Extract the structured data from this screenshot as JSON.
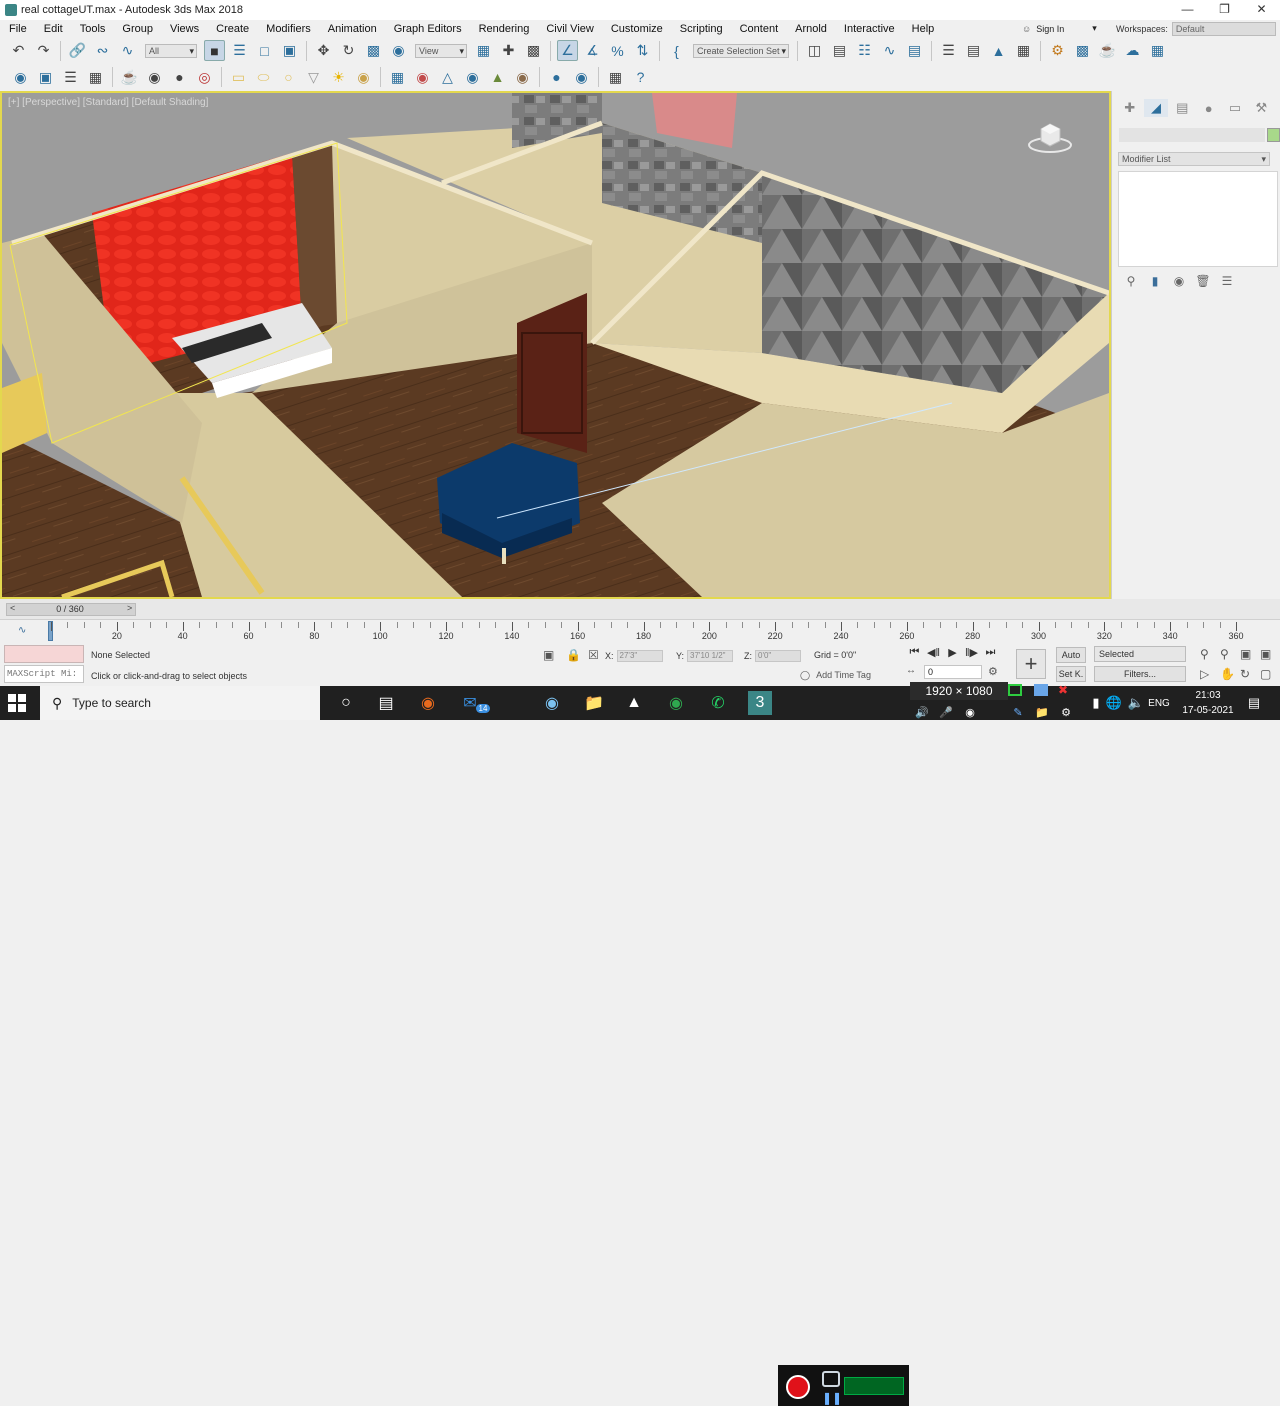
{
  "window": {
    "title": "real cottageUT.max - Autodesk 3ds Max 2018",
    "minimize": "—",
    "maximize": "❐",
    "close": "✕"
  },
  "menu": [
    "File",
    "Edit",
    "Tools",
    "Group",
    "Views",
    "Create",
    "Modifiers",
    "Animation",
    "Graph Editors",
    "Rendering",
    "Civil View",
    "Customize",
    "Scripting",
    "Content",
    "Arnold",
    "Interactive",
    "Help"
  ],
  "account": {
    "sign_in": "Sign In",
    "workspaces_label": "Workspaces:",
    "workspace": "Default"
  },
  "toolbar": {
    "selection_filter": "All",
    "ref_coord": "View",
    "named_selection": "Create Selection Set"
  },
  "viewport": {
    "label": "[+] [Perspective] [Standard] [Default Shading]"
  },
  "command_panel": {
    "modifier_list": "Modifier List",
    "object_color": "#a8d88a"
  },
  "timeline": {
    "slider": "0 / 360",
    "prev": "<",
    "next": ">",
    "playhead_frame": 0,
    "tick_labels": [
      "20",
      "40",
      "60",
      "80",
      "100",
      "120",
      "140",
      "160",
      "180",
      "200",
      "220",
      "240",
      "260",
      "280",
      "300",
      "320",
      "340",
      "360"
    ]
  },
  "status": {
    "maxscript": "MAXScript Mi:",
    "selection": "None Selected",
    "prompt": "Click or click-and-drag to select objects",
    "x_label": "X:",
    "x_value": "27'3\"",
    "y_label": "Y:",
    "y_value": "37'10 1/2\"",
    "z_label": "Z:",
    "z_value": "0'0\"",
    "grid": "Grid = 0'0\"",
    "add_time_tag": "Add Time Tag",
    "frame": "0",
    "auto": "Auto",
    "set_key": "Set K.",
    "key_filter": "Selected",
    "filters": "Filters..."
  },
  "taskbar": {
    "search_placeholder": "Type to search",
    "mail_badge": "14",
    "resolution": "1920 × 1080",
    "language": "ENG",
    "time": "21:03",
    "date": "17-05-2021"
  }
}
